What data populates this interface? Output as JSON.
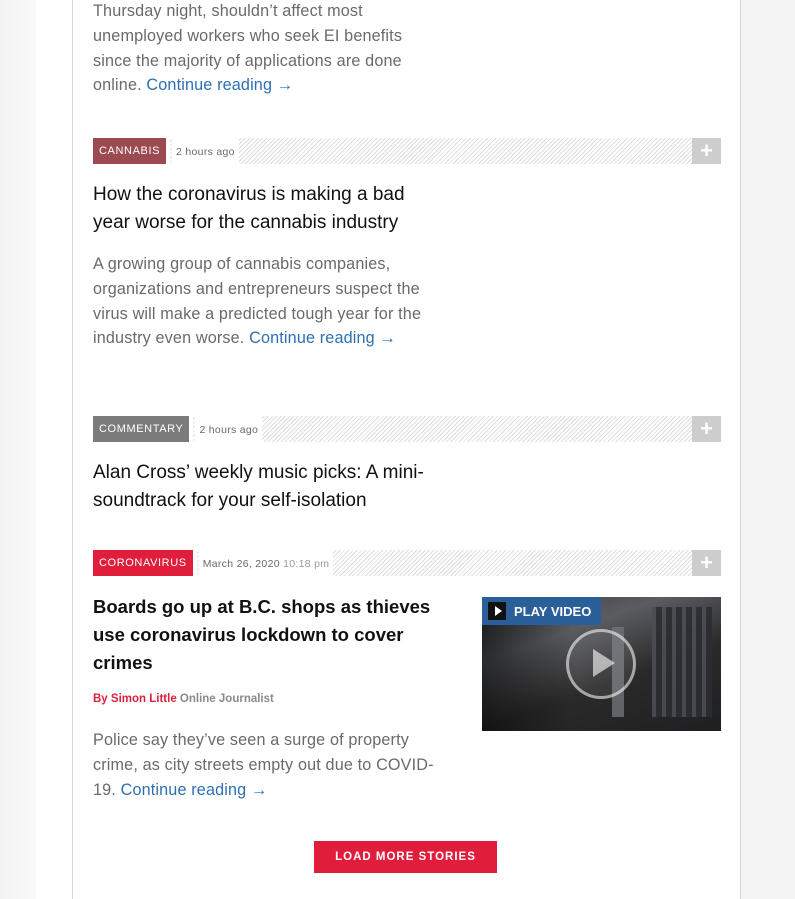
{
  "story_top": {
    "excerpt": "Thursday night, shouldn’t affect most unemployed workers who seek EI benefits since the majority of applications are done online.",
    "continue_label": "Continue reading →"
  },
  "stories": [
    {
      "tag": "Cannabis",
      "time": "2 hours ago",
      "plus": "+",
      "headline": "How the coronavirus is making a bad year worse for the cannabis industry",
      "excerpt": "A growing group of cannabis companies, organizations and entrepreneurs suspect the virus will make a predicted tough year for the industry even worse.",
      "continue_label": "Continue reading →"
    },
    {
      "tag": "Commentary",
      "time": "2 hours ago",
      "plus": "+",
      "headline": "Alan Cross’ weekly music picks: A mini-soundtrack for your self-isolation"
    },
    {
      "tag": "Coronavirus",
      "date": "March 26, 2020",
      "clock": "10:18 pm",
      "plus": "+",
      "headline": "Boards go up at B.C. shops as thieves use coronavirus lockdown to cover crimes",
      "byline_prefix": "By",
      "author": "Simon Little",
      "role": "Online Journalist",
      "video_label": "PLAY VIDEO",
      "excerpt": "Police say they’ve seen a surge of property crime, as city streets empty out due to COVID-19.",
      "continue_label": "Continue reading →"
    }
  ],
  "load_more_label": "Load more stories",
  "colors": {
    "accent_red": "#e01e3c",
    "link_blue": "#2d6fb4",
    "cannabis_tag": "#9b4a50",
    "commentary_tag": "#7b7b7b",
    "video_label_bg": "#2b5f9a"
  }
}
